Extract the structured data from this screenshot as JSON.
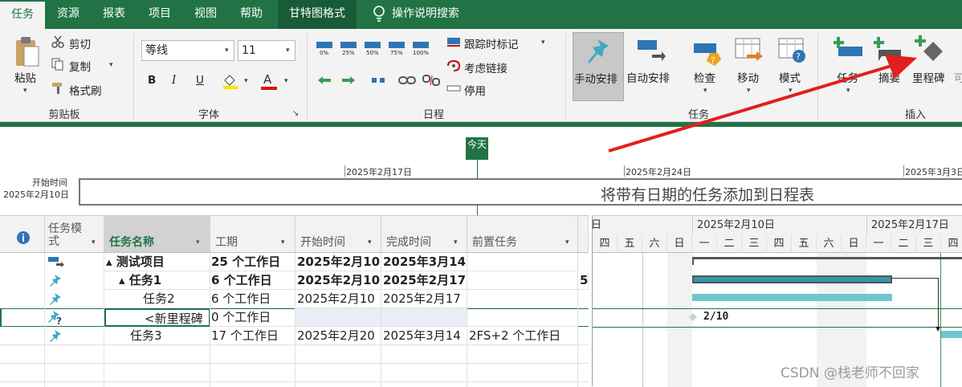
{
  "tabs": [
    "任务",
    "资源",
    "报表",
    "项目",
    "视图",
    "帮助",
    "甘特图格式",
    "操作说明搜索"
  ],
  "clipboard": {
    "paste": "粘贴",
    "cut": "剪切",
    "copy": "复制",
    "format_painter": "格式刷",
    "group": "剪贴板"
  },
  "font": {
    "name": "等线",
    "size": "11",
    "bold": "B",
    "italic": "I",
    "underline": "U",
    "color_letter": "A",
    "group": "字体"
  },
  "schedule": {
    "pct": [
      "0%",
      "25%",
      "50%",
      "75%",
      "100%"
    ],
    "mark_on_track": "跟踪时标记",
    "respect_links": "考虑链接",
    "inactivate": "停用",
    "group": "日程"
  },
  "tasks_grp": {
    "manual": "手动安排",
    "auto": "自动安排",
    "inspect": "检查",
    "move": "移动",
    "mode": "模式",
    "group": "任务"
  },
  "insert_grp": {
    "task": "任务",
    "summary": "摘要",
    "milestone": "里程碑",
    "more": "可",
    "group": "插入"
  },
  "timeline": {
    "today": "今天",
    "start_label": "开始时间",
    "start_date": "2025年2月10日",
    "ticks": [
      "2025年2月17日",
      "2025年2月24日",
      "2025年3月3日"
    ],
    "placeholder": "将带有日期的任务添加到日程表"
  },
  "grid": {
    "headers": {
      "mode": "任务模式",
      "name": "任务名称",
      "duration": "工期",
      "start": "开始时间",
      "finish": "完成时间",
      "pred": "前置任务"
    },
    "rows": [
      {
        "name": "▴ 测试项目",
        "duration": "25 个工作日",
        "start": "2025年2月10",
        "finish": "2025年3月14",
        "pred": "",
        "extra": ""
      },
      {
        "name": "▴ 任务1",
        "duration": "6 个工作日",
        "start": "2025年2月10",
        "finish": "2025年2月17",
        "pred": "",
        "extra": "5"
      },
      {
        "name": "任务2",
        "duration": "6 个工作日",
        "start": "2025年2月10",
        "finish": "2025年2月17",
        "pred": "",
        "extra": ""
      },
      {
        "name": "<新里程碑",
        "duration": "0 个工作日",
        "start": "",
        "finish": "",
        "pred": "",
        "extra": ""
      },
      {
        "name": "任务3",
        "duration": "17 个工作日",
        "start": "2025年2月20",
        "finish": "2025年3月14",
        "pred": "2FS+2 个工作日",
        "extra": ""
      }
    ]
  },
  "gantt": {
    "weeks": [
      "日",
      "2025年2月10日",
      "2025年2月17日"
    ],
    "days": [
      "四",
      "五",
      "六",
      "日",
      "一",
      "二",
      "三",
      "四",
      "五",
      "六",
      "日",
      "一",
      "二",
      "三",
      "四"
    ],
    "milestone_label": "2/10"
  },
  "watermark": "CSDN @栈老师不回家",
  "colors": {
    "accent": "#217346",
    "bar": "#6fc6cf",
    "summary": "#2e9aa8",
    "arrow": "#e02020"
  }
}
